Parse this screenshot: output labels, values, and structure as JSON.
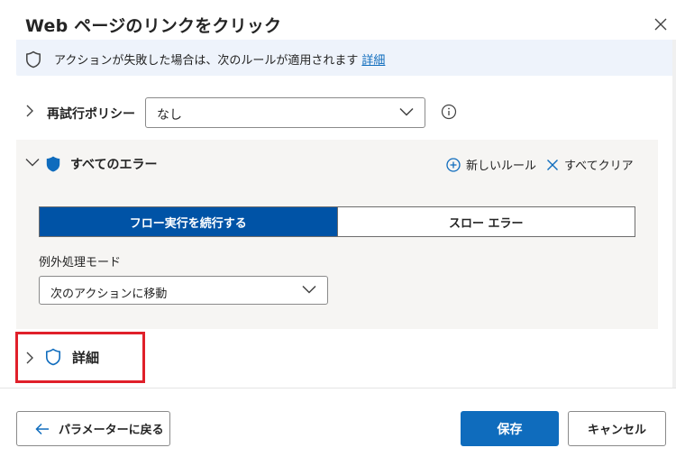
{
  "dialog": {
    "title": "Web ページのリンクをクリック",
    "close_icon": "close-icon"
  },
  "info_bar": {
    "text": "アクションが失敗した場合は、次のルールが適用されます",
    "link": "詳細",
    "icon": "shield-outline-icon"
  },
  "retry_policy": {
    "label": "再試行ポリシー",
    "value": "なし"
  },
  "errors": {
    "title": "すべてのエラー",
    "new_rule": "新しいルール",
    "clear_all": "すべてクリア",
    "toggle": {
      "options": [
        "フロー実行を続行する",
        "スロー エラー"
      ],
      "selected": "フロー実行を続行する"
    },
    "mode_label": "例外処理モード",
    "mode_value": "次のアクションに移動"
  },
  "details": {
    "label": "詳細"
  },
  "footer": {
    "back_label": "パラメーターに戻る",
    "save_label": "保存",
    "cancel_label": "キャンセル"
  },
  "colors": {
    "accent": "#0f6cbd",
    "toggle_active": "#0053a6",
    "highlight": "#e0202a",
    "info_bg": "#eef3fb",
    "panel_bg": "#f6f5f3"
  }
}
